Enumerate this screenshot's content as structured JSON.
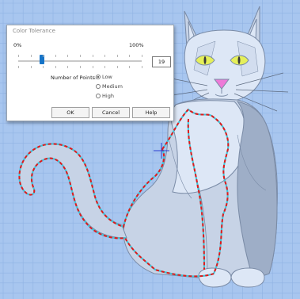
{
  "dialog": {
    "title": "Color Tolerance",
    "min_label": "0%",
    "max_label": "100%",
    "tolerance": {
      "value": "19",
      "fraction": 0.19
    },
    "points_label": "Number of Points:",
    "options": [
      "Low",
      "Medium",
      "High"
    ],
    "selected_option": "Low",
    "buttons": {
      "ok": "OK",
      "cancel": "Cancel",
      "help": "Help"
    }
  },
  "colors": {
    "background": "#a8c6ef",
    "grid": "#8fb2e3",
    "cat_light": "#dde7f6",
    "cat_mid": "#c7d3e6",
    "cat_dark": "#9eaec7",
    "outline": "#7a8ba6",
    "eyes": "#e5ef5a",
    "nose": "#ee7ad8",
    "dash_red": "#e11a1a",
    "dash_cyan": "#3fc3d6",
    "slider_accent": "#1674c8"
  }
}
